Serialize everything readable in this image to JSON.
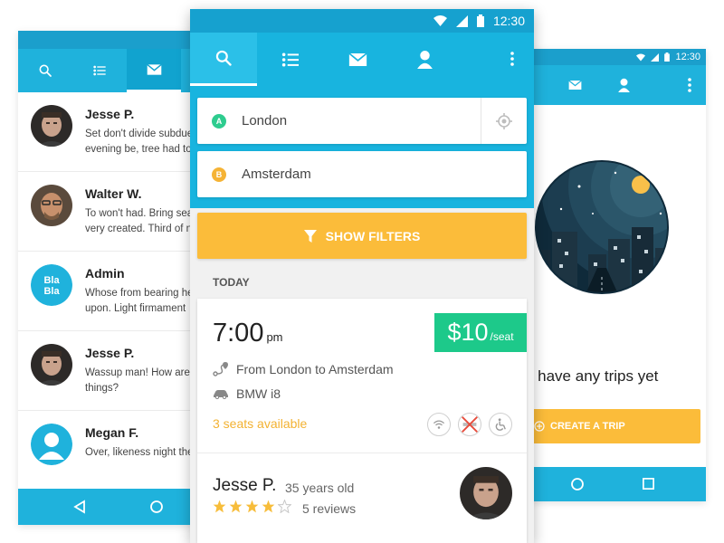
{
  "status_bar": {
    "time": "12:30"
  },
  "messages": [
    {
      "name": "Jesse P.",
      "preview": "Set don't divide subdue\nevening be, tree had to",
      "avatar": "jesse"
    },
    {
      "name": "Walter W.",
      "preview": "To won't had. Bring sea\nvery created. Third of n",
      "avatar": "walter"
    },
    {
      "name": "Admin",
      "preview": "Whose from bearing he\nupon. Light firmament",
      "avatar": "blabla",
      "avatar_text": "Bla Bla"
    },
    {
      "name": "Jesse P.",
      "preview": "Wassup man! How are\nthings?",
      "avatar": "jesse"
    },
    {
      "name": "Megan F.",
      "preview": "Over, likeness night the",
      "avatar": "placeholder"
    }
  ],
  "search": {
    "from": {
      "badge": "A",
      "value": "London"
    },
    "to": {
      "badge": "B",
      "value": "Amsterdam"
    },
    "filter_label": "SHOW FILTERS"
  },
  "trips_section": {
    "label": "TODAY"
  },
  "trip": {
    "time": "7:00",
    "ampm": "pm",
    "price": "$10",
    "price_unit": "/seat",
    "route": "From London to Amsterdam",
    "car": "BMW i8",
    "seats": "3 seats available",
    "amenities": [
      "wifi-icon",
      "no-smoking-icon",
      "wheelchair-icon"
    ],
    "driver": {
      "name": "Jesse P.",
      "age": "35 years old",
      "rating": 4,
      "rating_max": 5,
      "reviews": "5 reviews"
    }
  },
  "empty_trips": {
    "message": "n't have any trips yet",
    "button_label": "CREATE A TRIP"
  },
  "colors": {
    "primary": "#18b4df",
    "accent": "#fbbc3a",
    "green": "#1dc98a",
    "badge_a": "#2ecc8f",
    "badge_b": "#f5b335"
  }
}
